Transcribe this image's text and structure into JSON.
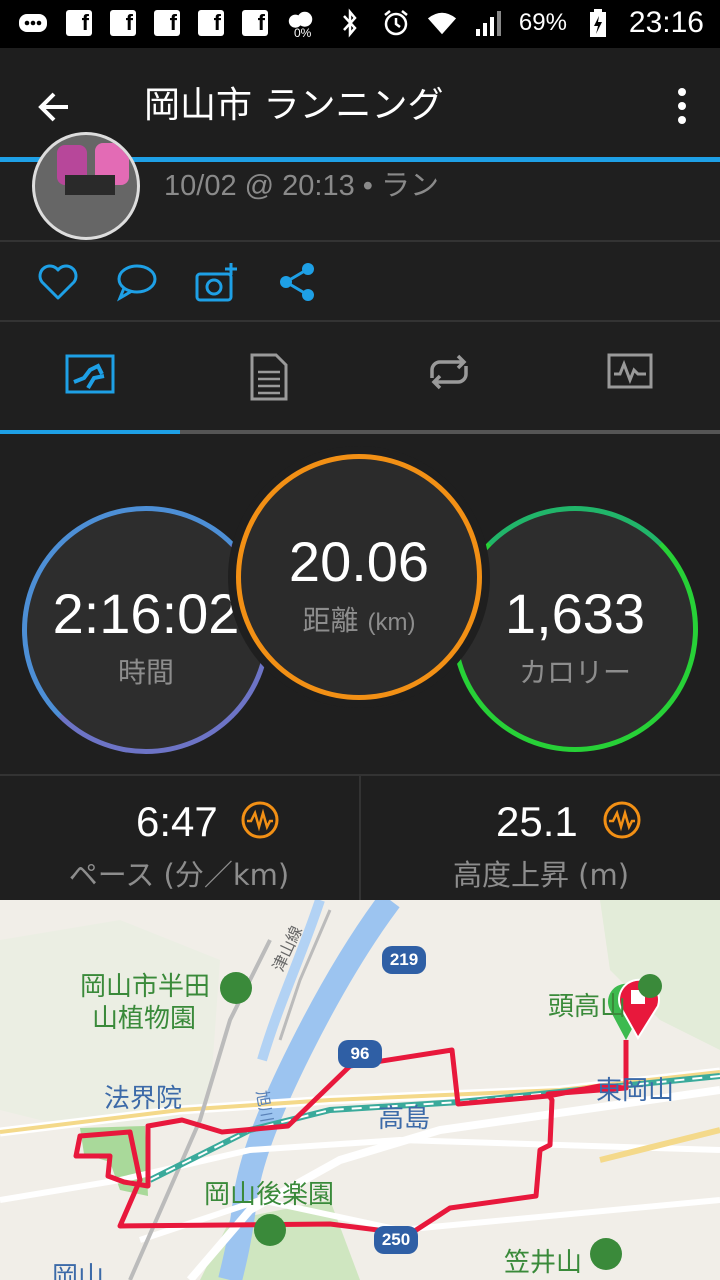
{
  "status_bar": {
    "battery": "69%",
    "time": "23:16",
    "data_saver": "0%"
  },
  "app_bar": {
    "title": "岡山市 ランニング"
  },
  "activity": {
    "meta": "10/02 @ 20:13 • ラン"
  },
  "stats": {
    "time": {
      "value": "2:16:02",
      "label": "時間"
    },
    "distance": {
      "value": "20.06",
      "label": "距離",
      "unit": "(km)"
    },
    "calories": {
      "value": "1,633",
      "label": "カロリー"
    },
    "pace": {
      "value": "6:47",
      "label": "ペース",
      "unit": "(分／km)"
    },
    "elevation": {
      "value": "25.1",
      "label": "高度上昇",
      "unit": "(m)"
    }
  },
  "map": {
    "labels": {
      "park1_line1": "岡山市半田",
      "park1_line2": "山植物園",
      "hokaiin": "法界院",
      "takashima": "高島",
      "higashi_okayama": "東岡山",
      "korakuen": "岡山後楽園",
      "kasaiyama": "笠井山",
      "zukoyama": "頭高山",
      "okayama": "岡山",
      "tsuyama_line": "津山線",
      "asahi_river": "旭川"
    },
    "routes": [
      "219",
      "96",
      "250"
    ]
  },
  "colors": {
    "accent": "#1ea0e6",
    "time_ring": "#5a86c8",
    "distance_ring": "#f29015",
    "calorie_ring": "#23c93f",
    "route": "#e8183c"
  }
}
